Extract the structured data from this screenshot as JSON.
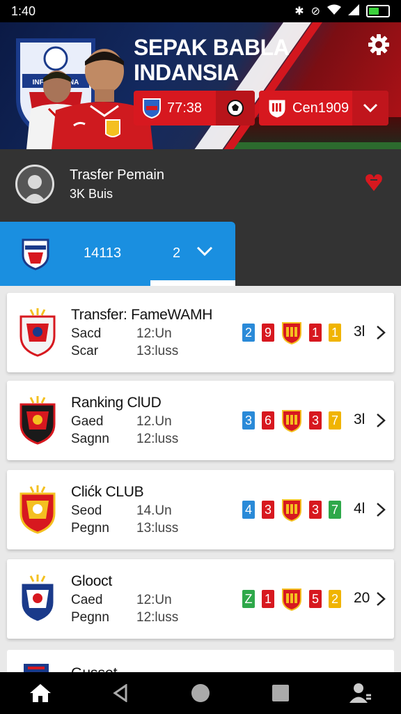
{
  "status_bar": {
    "time": "1:40",
    "icons": [
      "bluetooth-icon",
      "no-sound-icon",
      "wifi-icon",
      "signal-icon",
      "battery-icon"
    ],
    "battery_level": 0.55
  },
  "header": {
    "title_line1": "SEPAK BABLA",
    "title_line2": "INDANSIA",
    "crest_banner_text": "INFEREMANA",
    "score_text": "77:38",
    "center_label": "Cen1909",
    "accent_red": "#d7181f",
    "navy": "#13295f"
  },
  "profile": {
    "title": "Trasfer Pemain",
    "subtitle": "3K Buis"
  },
  "selector": {
    "code": "14113",
    "count": "2",
    "accent": "#1a8fe0"
  },
  "clubs": [
    {
      "title": "Transfer: FameWAMH",
      "row1_label": "Sacd",
      "row1_value": "12:Un",
      "row2_label": "Scar",
      "row2_value": "13:luss",
      "stats": [
        {
          "v": "2",
          "color": "#2a8ad8"
        },
        {
          "v": "9",
          "color": "#d7181f"
        },
        {
          "v": "crest"
        },
        {
          "v": "1",
          "color": "#d7181f"
        },
        {
          "v": "1",
          "color": "#f0b400"
        }
      ],
      "total": "3l"
    },
    {
      "title": "Ranking ClUD",
      "row1_label": "Gaed",
      "row1_value": "12.Un",
      "row2_label": "Sagnn",
      "row2_value": "12:luss",
      "stats": [
        {
          "v": "3",
          "color": "#2a8ad8"
        },
        {
          "v": "6",
          "color": "#d7181f"
        },
        {
          "v": "crest"
        },
        {
          "v": "3",
          "color": "#d7181f"
        },
        {
          "v": "7",
          "color": "#f0b400"
        }
      ],
      "total": "3l"
    },
    {
      "title": "Clićk CLUB",
      "row1_label": "Seod",
      "row1_value": "14.Un",
      "row2_label": "Pegnn",
      "row2_value": "13:luss",
      "stats": [
        {
          "v": "4",
          "color": "#2a8ad8"
        },
        {
          "v": "3",
          "color": "#d7181f"
        },
        {
          "v": "crest"
        },
        {
          "v": "3",
          "color": "#d7181f"
        },
        {
          "v": "7",
          "color": "#2ea84a"
        }
      ],
      "total": "4l"
    },
    {
      "title": "Glooct",
      "row1_label": "Caed",
      "row1_value": "12:Un",
      "row2_label": "Pegnn",
      "row2_value": "12:luss",
      "stats": [
        {
          "v": "Z",
          "color": "#2ea84a"
        },
        {
          "v": "1",
          "color": "#d7181f"
        },
        {
          "v": "crest"
        },
        {
          "v": "5",
          "color": "#d7181f"
        },
        {
          "v": "2",
          "color": "#f0b400"
        }
      ],
      "total": "20"
    }
  ],
  "partial_club": {
    "title": "Gusset"
  },
  "nav": [
    "home-icon",
    "back-icon",
    "home-circle-icon",
    "recents-icon",
    "account-icon"
  ]
}
